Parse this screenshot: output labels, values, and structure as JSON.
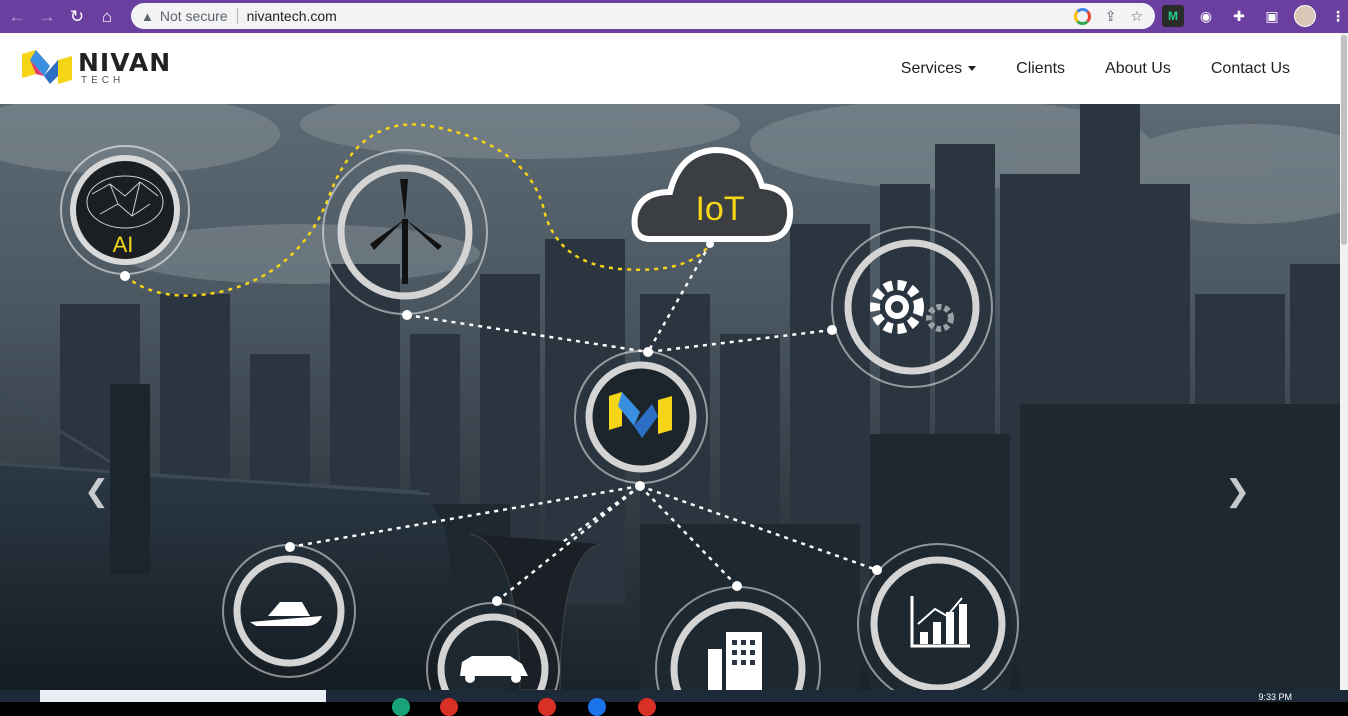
{
  "browser": {
    "security_label": "Not secure",
    "url": "nivantech.com",
    "extensions": [
      "M",
      "ext-2",
      "puzzle",
      "sidebar"
    ]
  },
  "site": {
    "logo_name": "NIVAN",
    "logo_sub": "TECH",
    "nav": {
      "services": "Services",
      "clients": "Clients",
      "about": "About Us",
      "contact": "Contact Us"
    }
  },
  "hero": {
    "ai_label": "AI",
    "iot_label": "IoT",
    "nodes": [
      "ai-brain-icon",
      "wind-turbine-icon",
      "iot-cloud-icon",
      "gear-icon",
      "nivan-logo-icon",
      "boat-icon",
      "car-icon",
      "building-icon",
      "bar-chart-icon"
    ]
  },
  "colors": {
    "chrome": "#6b3fa0",
    "accent_yellow": "#f5d516",
    "accent_blue": "#3b8fe0",
    "node_ring": "#ffffff"
  },
  "taskbar": {
    "clock": "9:33 PM"
  }
}
